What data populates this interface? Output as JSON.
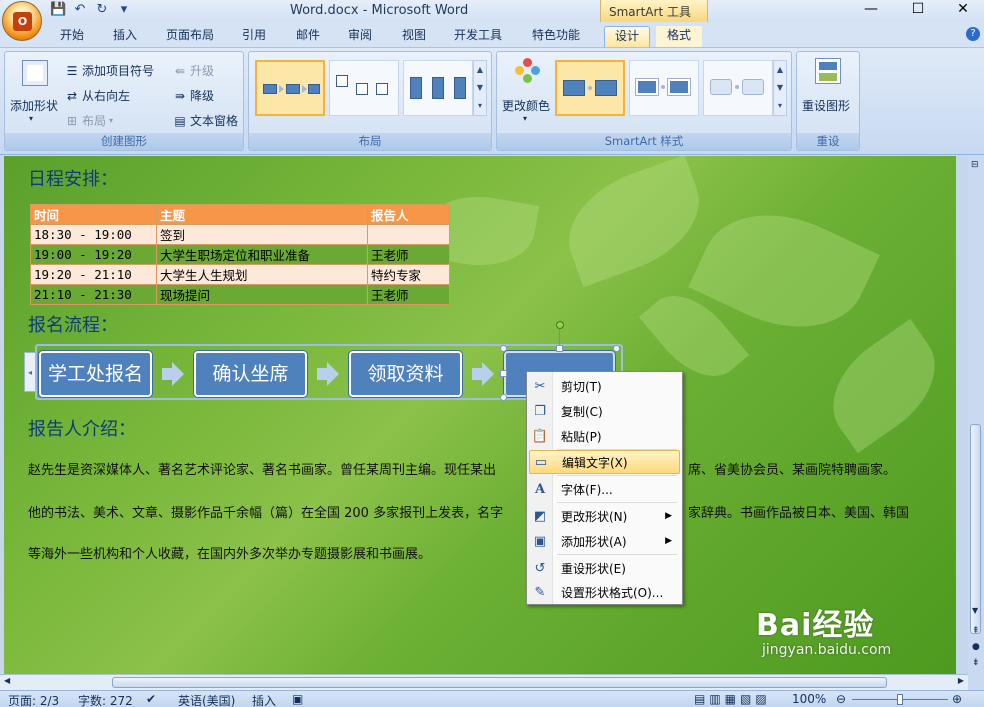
{
  "window": {
    "title": "Word.docx - Microsoft Word",
    "context_tool": "SmartArt 工具",
    "controls": [
      "—",
      "☐",
      "✕"
    ]
  },
  "tabs": [
    "开始",
    "插入",
    "页面布局",
    "引用",
    "邮件",
    "审阅",
    "视图",
    "开发工具",
    "特色功能",
    "设计",
    "格式"
  ],
  "active_tab": "设计",
  "ribbon": {
    "create_group": {
      "label": "创建图形",
      "add_shape": "添加形状",
      "add_bullet": "添加项目符号",
      "rtl": "从右向左",
      "layout": "布局",
      "promote": "升级",
      "demote": "降级",
      "text_pane": "文本窗格"
    },
    "layout_group": {
      "label": "布局"
    },
    "style_group": {
      "label": "SmartArt 样式",
      "change_color": "更改颜色"
    },
    "reset_group": {
      "label": "重设",
      "reset_graphic": "重设图形"
    }
  },
  "document": {
    "heading_schedule": "日程安排：",
    "schedule_table": {
      "headers": [
        "时间",
        "主题",
        "报告人"
      ],
      "rows": [
        [
          "18:30 - 19:00",
          "签到",
          ""
        ],
        [
          "19:00 - 19:20",
          "大学生职场定位和职业准备",
          "王老师"
        ],
        [
          "19:20 - 21:10",
          "大学生人生规划",
          "特约专家"
        ],
        [
          "21:10 - 21:30",
          "现场提问",
          "王老师"
        ]
      ]
    },
    "heading_process": "报名流程：",
    "process_steps": [
      "学工处报名",
      "确认坐席",
      "领取资料",
      ""
    ],
    "heading_speaker": "报告人介绍：",
    "paragraph_lines": [
      "赵先生是资深媒体人、著名艺术评论家、著名书画家。曾任某周刊主编。现任某出",
      "他的书法、美术、文章、摄影作品千余幅（篇）在全国 200 多家报刊上发表，名字",
      "等海外一些机构和个人收藏，在国内外多次举办专题摄影展和书画展。"
    ],
    "paragraph_tail_lines": [
      "席、省美协会员、某画院特聘画家。",
      "家辞典。书画作品被日本、美国、韩国"
    ]
  },
  "context_menu": {
    "items": [
      {
        "label": "剪切(T)",
        "icon": "scissors-icon",
        "submenu": false
      },
      {
        "label": "复制(C)",
        "icon": "copy-icon",
        "submenu": false
      },
      {
        "label": "粘贴(P)",
        "icon": "paste-icon",
        "submenu": false
      },
      {
        "label": "编辑文字(X)",
        "icon": "edit-text-icon",
        "submenu": false,
        "highlighted": true
      },
      {
        "label": "字体(F)...",
        "icon": "font-icon",
        "submenu": false
      },
      {
        "label": "更改形状(N)",
        "icon": "change-shape-icon",
        "submenu": true
      },
      {
        "label": "添加形状(A)",
        "icon": "add-shape-icon",
        "submenu": true
      },
      {
        "label": "重设形状(E)",
        "icon": "reset-shape-icon",
        "submenu": false
      },
      {
        "label": "设置形状格式(O)...",
        "icon": "format-shape-icon",
        "submenu": false
      }
    ]
  },
  "status": {
    "page": "页面: 2/3",
    "words": "字数: 272",
    "language": "英语(美国)",
    "mode": "插入",
    "zoom": "100%"
  },
  "watermark": {
    "brand": "Bai经验",
    "url": "jingyan.baidu.com"
  },
  "colors": {
    "table_header": "#f79646",
    "smartart_box": "#4f81bd",
    "menu_highlight": "#ffd97d",
    "page_green": "#6cb034"
  }
}
